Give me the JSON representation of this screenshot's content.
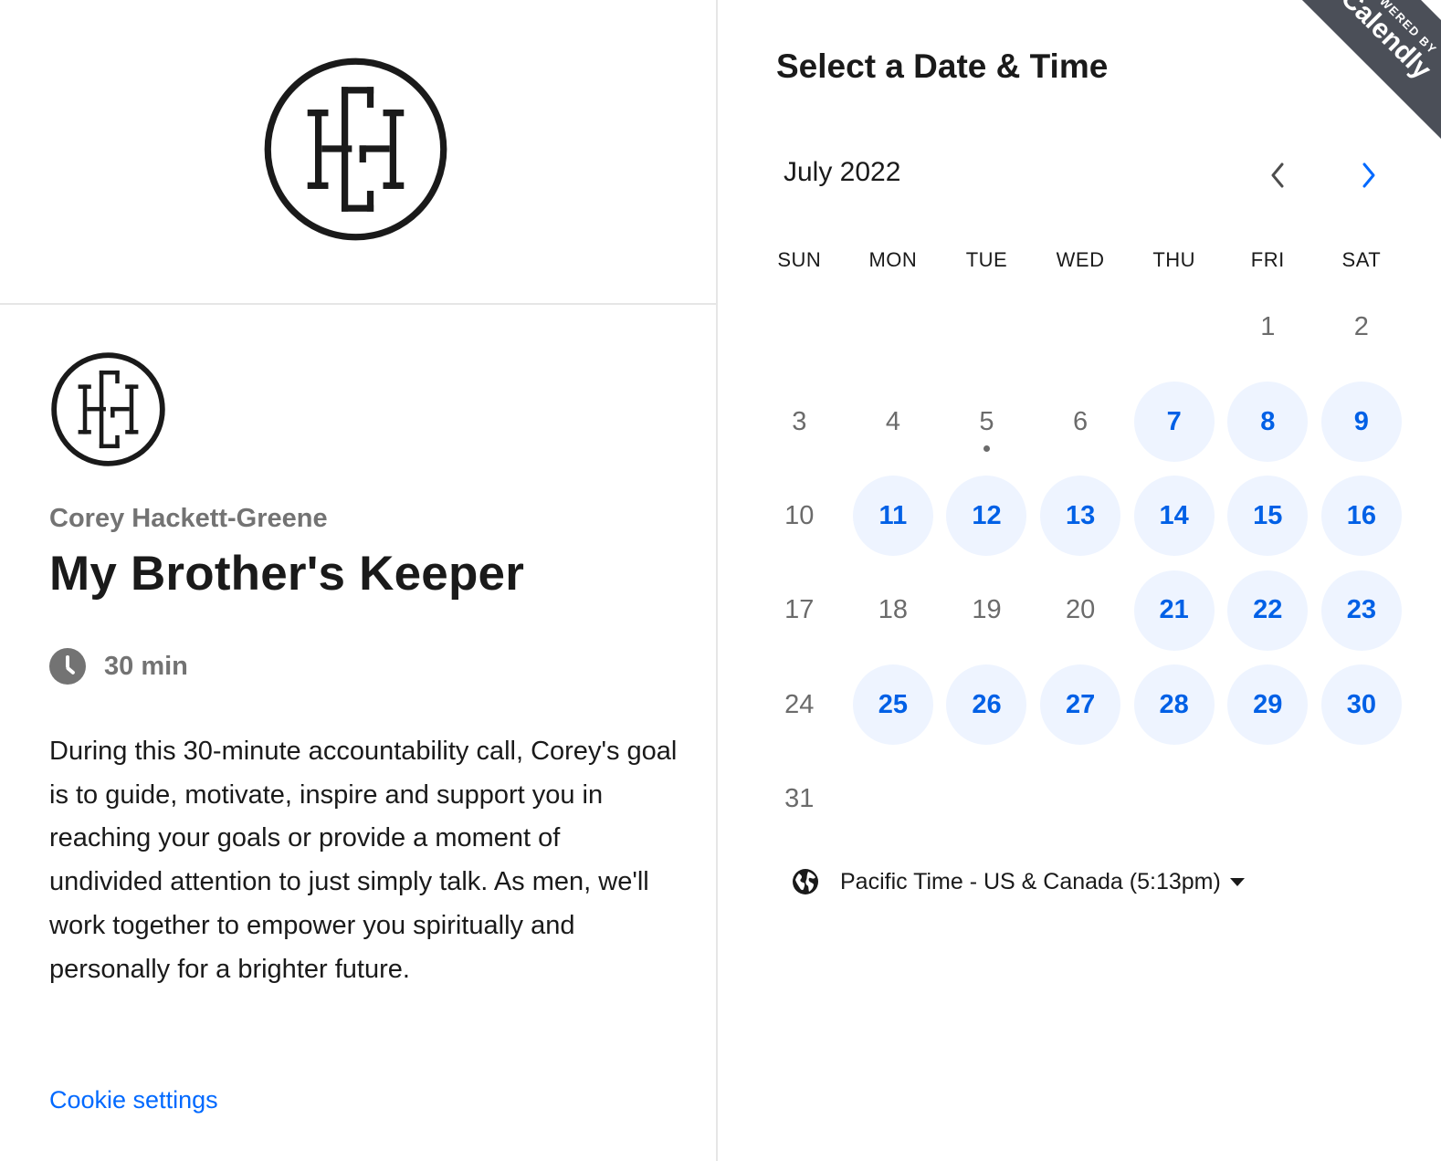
{
  "logo_text": "CH",
  "organizer": "Corey Hackett-Greene",
  "event_title": "My Brother's Keeper",
  "duration": "30 min",
  "description": "During this 30-minute accountability call, Corey's goal is to guide, motivate, inspire and support you in reaching your goals or provide a moment of undivided attention to just simply talk. As men, we'll work together to empower you spiritually and personally for a brighter future.",
  "cookie_settings": "Cookie settings",
  "calendar": {
    "heading": "Select a Date & Time",
    "month_label": "July 2022",
    "weekdays": [
      "SUN",
      "MON",
      "TUE",
      "WED",
      "THU",
      "FRI",
      "SAT"
    ],
    "weeks": [
      [
        null,
        null,
        null,
        null,
        null,
        {
          "d": "1",
          "a": false
        },
        {
          "d": "2",
          "a": false
        }
      ],
      [
        {
          "d": "3",
          "a": false
        },
        {
          "d": "4",
          "a": false
        },
        {
          "d": "5",
          "a": false,
          "today": true
        },
        {
          "d": "6",
          "a": false
        },
        {
          "d": "7",
          "a": true
        },
        {
          "d": "8",
          "a": true
        },
        {
          "d": "9",
          "a": true
        }
      ],
      [
        {
          "d": "10",
          "a": false
        },
        {
          "d": "11",
          "a": true
        },
        {
          "d": "12",
          "a": true
        },
        {
          "d": "13",
          "a": true
        },
        {
          "d": "14",
          "a": true
        },
        {
          "d": "15",
          "a": true
        },
        {
          "d": "16",
          "a": true
        }
      ],
      [
        {
          "d": "17",
          "a": false
        },
        {
          "d": "18",
          "a": false
        },
        {
          "d": "19",
          "a": false
        },
        {
          "d": "20",
          "a": false
        },
        {
          "d": "21",
          "a": true
        },
        {
          "d": "22",
          "a": true
        },
        {
          "d": "23",
          "a": true
        }
      ],
      [
        {
          "d": "24",
          "a": false
        },
        {
          "d": "25",
          "a": true
        },
        {
          "d": "26",
          "a": true
        },
        {
          "d": "27",
          "a": true
        },
        {
          "d": "28",
          "a": true
        },
        {
          "d": "29",
          "a": true
        },
        {
          "d": "30",
          "a": true
        }
      ],
      [
        {
          "d": "31",
          "a": false
        },
        null,
        null,
        null,
        null,
        null,
        null
      ]
    ],
    "timezone": "Pacific Time - US & Canada (5:13pm)"
  },
  "badge": {
    "powered_by": "POWERED BY",
    "brand": "Calendly"
  },
  "colors": {
    "accent": "#0069ff",
    "available_bg": "#eef4ff",
    "ribbon": "#4b4f58",
    "muted": "#737373"
  }
}
